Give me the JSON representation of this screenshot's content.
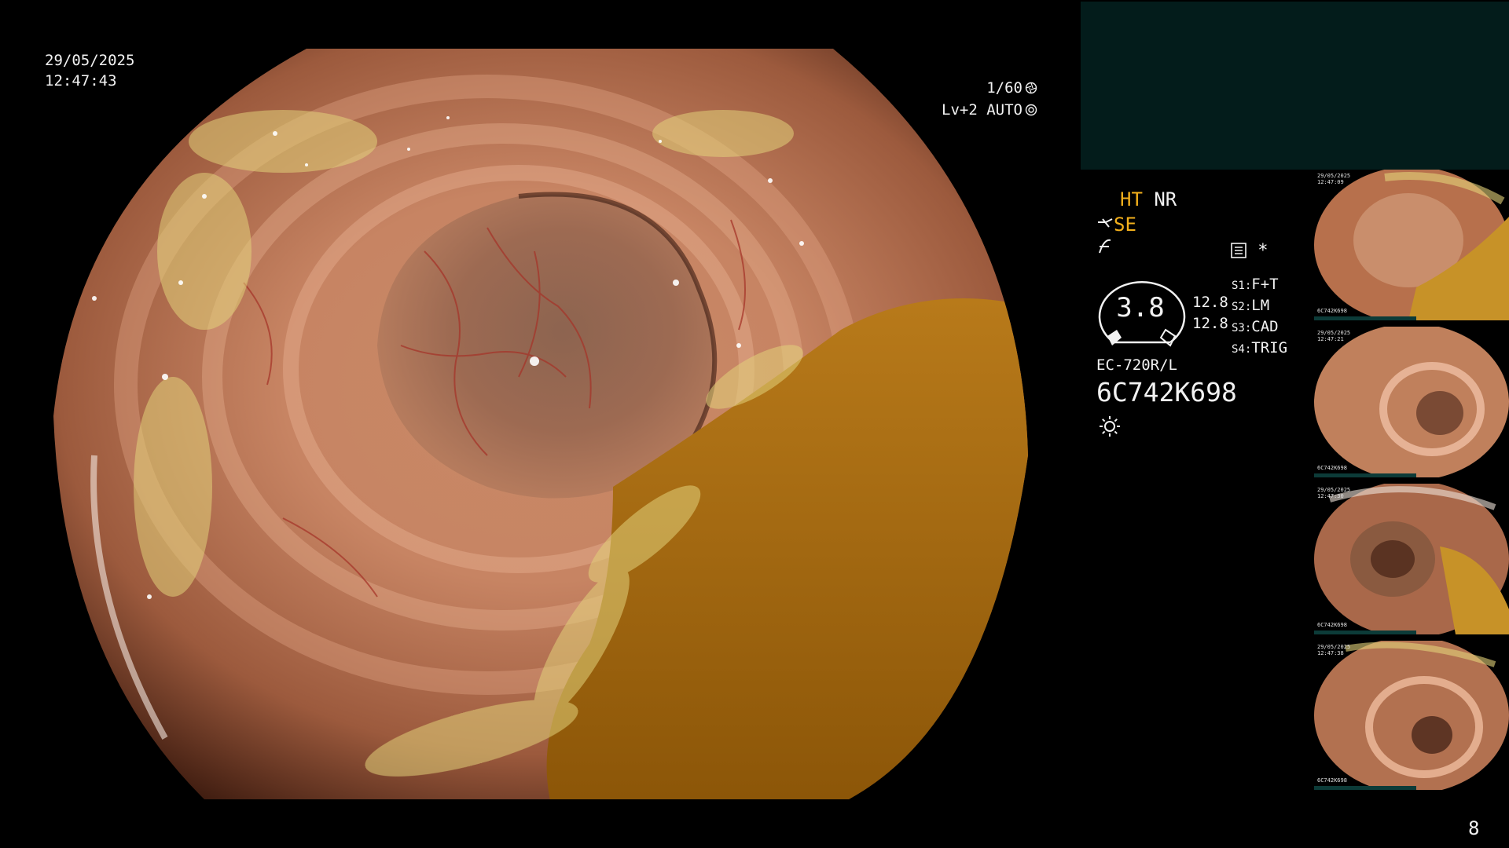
{
  "main_view": {
    "date": "29/05/2025",
    "time": "12:47:43",
    "shutter": "1/60",
    "shutter_icon": "aperture-icon",
    "level": "Lv+2",
    "exposure_mode": "AUTO",
    "exposure_icon": "auto-iris-icon"
  },
  "info_panel": {
    "ht": "HT",
    "nr": "NR",
    "se": "SE",
    "se_icon": "structure-enhance-icon",
    "func_icon": "function-icon",
    "record_icon": "recorder-icon",
    "star": "*",
    "zoom": "3.8",
    "values": [
      "12.8",
      "12.8"
    ],
    "switches": [
      {
        "key": "S1:",
        "value": "F+T"
      },
      {
        "key": "S2:",
        "value": "LM"
      },
      {
        "key": "S3:",
        "value": "CAD"
      },
      {
        "key": "S4:",
        "value": "TRIG"
      }
    ],
    "scope_model": "EC-720R/L",
    "scope_serial": "6C742K698",
    "light_icon": "sun-icon"
  },
  "thumbnails": [
    {
      "meta": "29/05/2025\n12:47:09",
      "serial": "6C742K698"
    },
    {
      "meta": "29/05/2025\n12:47:21",
      "serial": "6C742K698"
    },
    {
      "meta": "29/05/2025\n12:47:30",
      "serial": "6C742K698"
    },
    {
      "meta": "29/05/2025\n12:47:38",
      "serial": "6C742K698"
    }
  ],
  "page_number": "8",
  "colors": {
    "accent_orange": "#f3b01c",
    "panel_teal": "#031c1b",
    "text": "#f2f2f2"
  }
}
